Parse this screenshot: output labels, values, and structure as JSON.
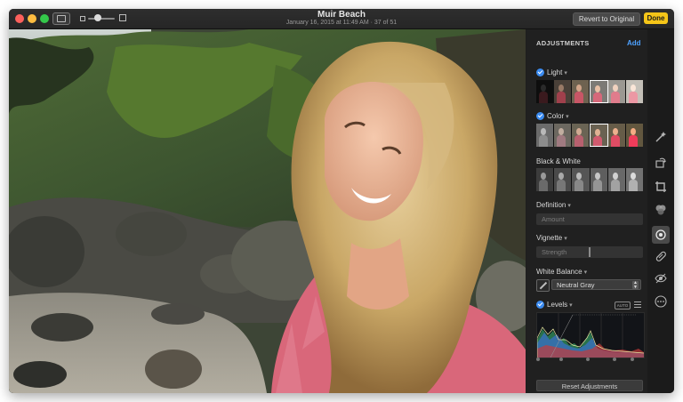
{
  "window": {
    "title": "Muir Beach",
    "subtitle": "January 16, 2015 at 11:49 AM · 37 of 51",
    "revert_label": "Revert to Original",
    "done_label": "Done"
  },
  "panel": {
    "title": "ADJUSTMENTS",
    "add_label": "Add",
    "sections": {
      "light": {
        "label": "Light",
        "checked": true
      },
      "color": {
        "label": "Color",
        "checked": true
      },
      "bw": {
        "label": "Black & White",
        "checked": false
      },
      "definition": {
        "label": "Definition",
        "slider_label": "Amount"
      },
      "vignette": {
        "label": "Vignette",
        "slider_label": "Strength"
      },
      "white_balance": {
        "label": "White Balance",
        "selected": "Neutral Gray"
      },
      "levels": {
        "label": "Levels",
        "checked": true,
        "auto_label": "AUTO"
      }
    },
    "reset_label": "Reset Adjustments"
  },
  "toolbar_icons": [
    "magic-wand-icon",
    "rotate-icon",
    "crop-icon",
    "filters-icon",
    "adjust-icon",
    "retouch-icon",
    "red-eye-icon",
    "more-icon"
  ],
  "colors": {
    "accent_blue": "#3b8bf0",
    "done_yellow": "#f5c518",
    "panel_bg": "#202020"
  }
}
